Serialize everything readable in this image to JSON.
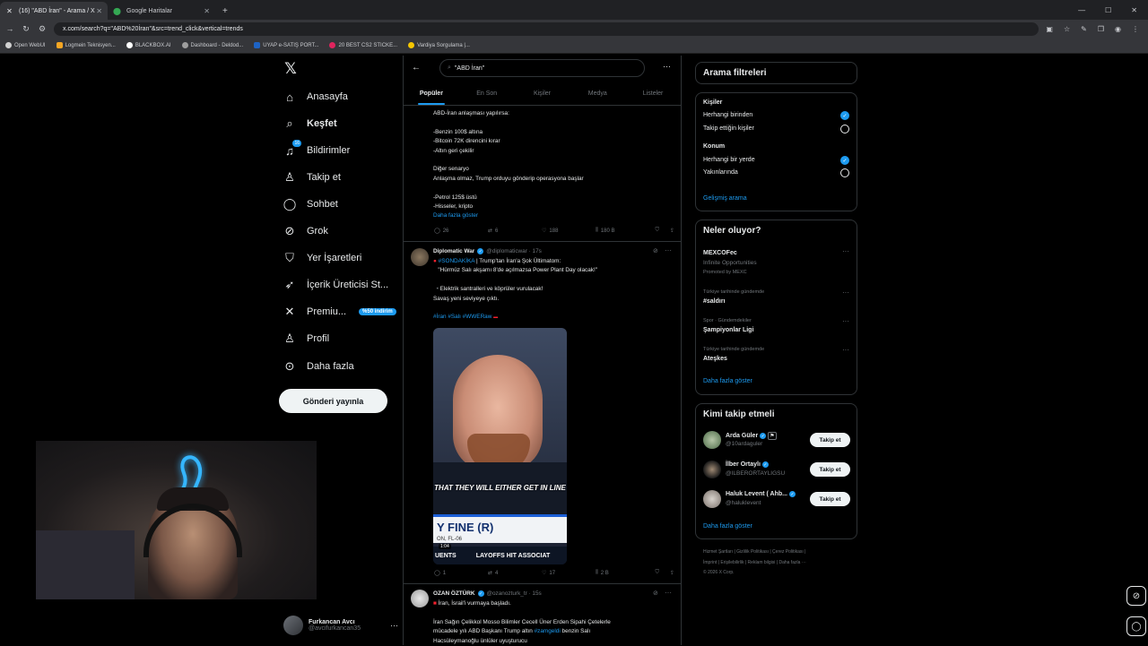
{
  "browser": {
    "tabs": [
      {
        "title": "(16) \"ABD İran\" - Arama / X",
        "active": true
      },
      {
        "title": "Google Haritalar",
        "active": false
      }
    ],
    "url": "x.com/search?q=\"ABD%20İran\"&src=trend_click&vertical=trends",
    "bookmarks": [
      "Open WebUI",
      "Logmein Teknisyen...",
      "BLACKBOX.AI",
      "Dashboard - Deldod...",
      "UYAP e-SATIŞ PORT...",
      "20 BEST CS2 STICKE...",
      "Vardiya Sorgulama |..."
    ]
  },
  "nav": {
    "items": [
      {
        "label": "Anasayfa",
        "icon": "home-icon",
        "glyph": "⌂"
      },
      {
        "label": "Keşfet",
        "icon": "search-icon",
        "glyph": "⌕",
        "bold": true
      },
      {
        "label": "Bildirimler",
        "icon": "bell-icon",
        "glyph": "♫",
        "badge": "16"
      },
      {
        "label": "Takip et",
        "icon": "follow-icon",
        "glyph": "♙"
      },
      {
        "label": "Sohbet",
        "icon": "chat-icon",
        "glyph": "◯"
      },
      {
        "label": "Grok",
        "icon": "grok-icon",
        "glyph": "⊘"
      },
      {
        "label": "Yer İşaretleri",
        "icon": "bookmark-icon",
        "glyph": "⛉"
      },
      {
        "label": "İçerik Üreticisi St...",
        "icon": "rocket-icon",
        "glyph": "➶"
      },
      {
        "label": "Premiu...",
        "icon": "x-premium-icon",
        "glyph": "✕",
        "promo": "%50 indirim"
      },
      {
        "label": "Profil",
        "icon": "profile-icon",
        "glyph": "♙"
      },
      {
        "label": "Daha fazla",
        "icon": "more-icon",
        "glyph": "⊙"
      }
    ],
    "post_button": "Gönderi yayınla"
  },
  "account": {
    "name": "Furkancan Avcı",
    "handle": "@avcifurkancan35"
  },
  "search": {
    "query": "\"ABD İran\"",
    "tabs": [
      "Popüler",
      "En Son",
      "Kişiler",
      "Medya",
      "Listeler"
    ]
  },
  "tweet1": {
    "lines": [
      "ABD-İran anlaşması yapılırsa:",
      "",
      "-Benzin 100$ altına",
      "-Bitcoin 72K direncini kırar",
      "-Altın geri çekilir",
      "",
      "Diğer senaryo",
      "Anlaşma olmaz, Trump orduyu gönderip operasyona başlar",
      "",
      "-Petrol 125$ üstü",
      "-Hisseler, kripto"
    ],
    "show_more": "Daha fazla göster",
    "replies": "26",
    "reposts": "6",
    "likes": "188",
    "views": "180 B"
  },
  "tweet2": {
    "name": "Diplomatic War",
    "handle": "@diplomaticwar · 17s",
    "tag": "#SONDAKİKA",
    "headline": "| Trump'tan İran'a Şok Ültimatom:",
    "quote": "\"Hürmüz Salı akşamı 8'de açılmazsa Power Plant Day olacak!\"",
    "line2": "Elektrik santralleri ve köprüler vurulacak!",
    "line3": "Savaş yeni seviyeye çıktı.",
    "hashtags": "#İran #Salı #WWERaw",
    "video": {
      "caption": "THAT THEY WILL EITHER GET IN LINE",
      "lower_big": "Y FINE (R)",
      "lower_small": "ON, FL-06",
      "strip_left": "UENTS",
      "strip_right": "LAYOFFS HIT ASSOCIAT",
      "time": "1:04"
    },
    "replies": "1",
    "reposts": "4",
    "likes": "17",
    "views": "2 B"
  },
  "tweet3": {
    "name": "OZAN ÖZTÜRK",
    "handle": "@ozanozturk_tr · 15s",
    "line1": "İran, İsrail'i vurmaya başladı.",
    "line2": "İran Sağın Çelikkol Mosso Bilimler Cecell Üner Erden Sipahi Çetelerle",
    "line3a": "mücadele yılı ABD Başkanı Trump altın ",
    "line3link": "#zamgeldi",
    "line3b": " benzin Salı",
    "line4": "Hacsüleymanoğlu ünlüler uyuşturucu"
  },
  "filters": {
    "title": "Arama filtreleri",
    "people_label": "Kişiler",
    "people_opts": [
      "Herhangi birinden",
      "Takip ettiğin kişiler"
    ],
    "loc_label": "Konum",
    "loc_opts": [
      "Herhangi bir yerde",
      "Yakınlarında"
    ],
    "advanced": "Gelişmiş arama"
  },
  "trends": {
    "title": "Neler oluyor?",
    "promo_name": "MEXCOFec",
    "promo_sub": "Infinite Opportunities",
    "promo_by": "Promoted by MEXC",
    "items": [
      {
        "meta": "Türkiye tarihinde gündemde",
        "name": "#saldırı"
      },
      {
        "meta": "Spor · Gündemdekiler",
        "name": "Şampiyonlar Ligi"
      },
      {
        "meta": "Türkiye tarihinde gündemde",
        "name": "Ateşkes"
      }
    ],
    "show_more": "Daha fazla göster"
  },
  "who_to_follow": {
    "title": "Kimi takip etmeli",
    "people": [
      {
        "name": "Arda Güler",
        "handle": "@10ardaguler"
      },
      {
        "name": "İlber Ortaylı",
        "handle": "@ILBERORTAYLIGSU"
      },
      {
        "name": "Haluk Levent ( Ahb...",
        "handle": "@haluklevent"
      }
    ],
    "follow_label": "Takip et",
    "show_more": "Daha fazla göster"
  },
  "footer": {
    "line1": "Hizmet Şartları  |  Gizlilik Politikası  |  Çerez Politikası  |",
    "line2": "İmprint  |  Erişilebilirlik  |  Reklam bilgisi  |  Daha fazla ···",
    "line3": "© 2026 X Corp."
  }
}
